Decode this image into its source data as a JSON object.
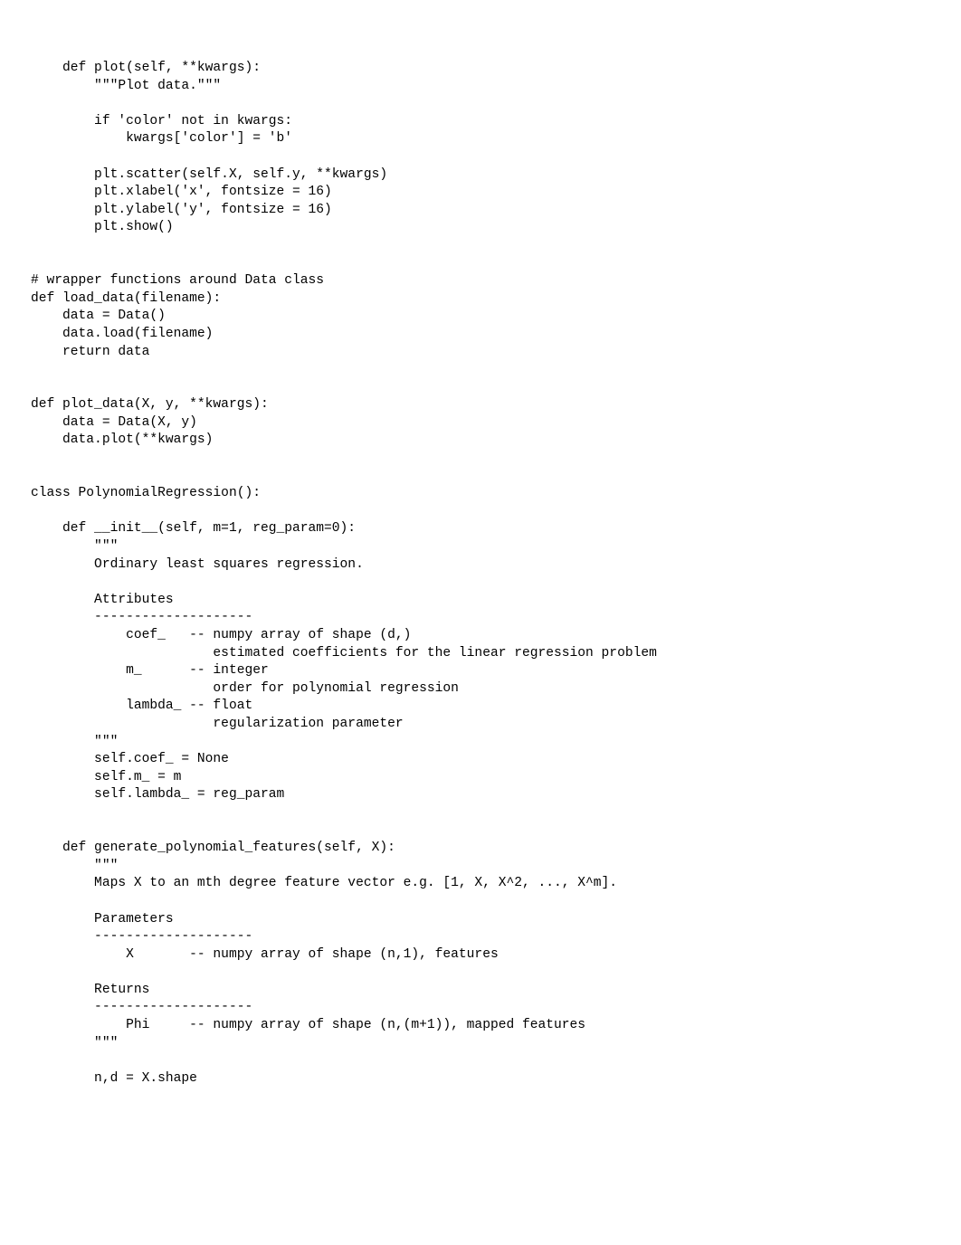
{
  "code": {
    "lines": [
      "    def plot(self, **kwargs):",
      "        \"\"\"Plot data.\"\"\"",
      "",
      "        if 'color' not in kwargs:",
      "            kwargs['color'] = 'b'",
      "",
      "        plt.scatter(self.X, self.y, **kwargs)",
      "        plt.xlabel('x', fontsize = 16)",
      "        plt.ylabel('y', fontsize = 16)",
      "        plt.show()",
      "",
      "",
      "# wrapper functions around Data class",
      "def load_data(filename):",
      "    data = Data()",
      "    data.load(filename)",
      "    return data",
      "",
      "",
      "def plot_data(X, y, **kwargs):",
      "    data = Data(X, y)",
      "    data.plot(**kwargs)",
      "",
      "",
      "class PolynomialRegression():",
      "",
      "    def __init__(self, m=1, reg_param=0):",
      "        \"\"\"",
      "        Ordinary least squares regression.",
      "",
      "        Attributes",
      "        --------------------",
      "            coef_   -- numpy array of shape (d,)",
      "                       estimated coefficients for the linear regression problem",
      "            m_      -- integer",
      "                       order for polynomial regression",
      "            lambda_ -- float",
      "                       regularization parameter",
      "        \"\"\"",
      "        self.coef_ = None",
      "        self.m_ = m",
      "        self.lambda_ = reg_param",
      "",
      "",
      "    def generate_polynomial_features(self, X):",
      "        \"\"\"",
      "        Maps X to an mth degree feature vector e.g. [1, X, X^2, ..., X^m].",
      "",
      "        Parameters",
      "        --------------------",
      "            X       -- numpy array of shape (n,1), features",
      "",
      "        Returns",
      "        --------------------",
      "            Phi     -- numpy array of shape (n,(m+1)), mapped features",
      "        \"\"\"",
      "",
      "        n,d = X.shape"
    ]
  }
}
